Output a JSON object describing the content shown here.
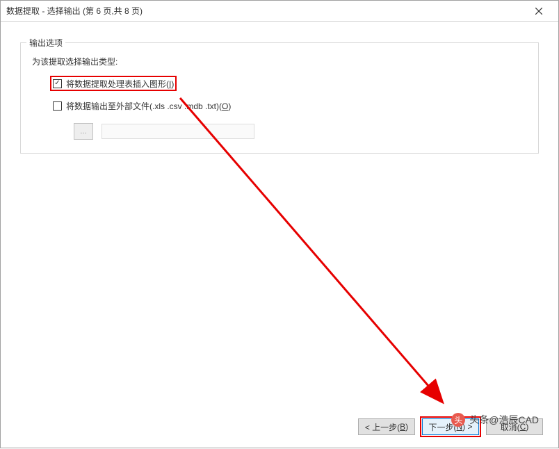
{
  "titlebar": {
    "title": "数据提取 - 选择输出 (第 6 页,共 8 页)"
  },
  "fieldset": {
    "legend": "输出选项",
    "section_label": "为该提取选择输出类型:",
    "checkbox1": {
      "checked": true,
      "label_main": "将数据提取处理表插入图形(",
      "label_key": "I",
      "label_end": ")"
    },
    "checkbox2": {
      "checked": false,
      "label_main": "将数据输出至外部文件(.xls .csv .mdb .txt)(",
      "label_key": "O",
      "label_end": ")"
    },
    "browse_label": "…",
    "path_value": ""
  },
  "footer": {
    "back": {
      "prefix": "< 上一步(",
      "key": "B",
      "suffix": ")"
    },
    "next": {
      "prefix": "下一步(",
      "key": "N",
      "suffix": ") >"
    },
    "cancel": {
      "prefix": "取消(",
      "key": "C",
      "suffix": ")"
    }
  },
  "watermark": {
    "text": "头条@浩辰CAD",
    "icon_glyph": "头"
  }
}
